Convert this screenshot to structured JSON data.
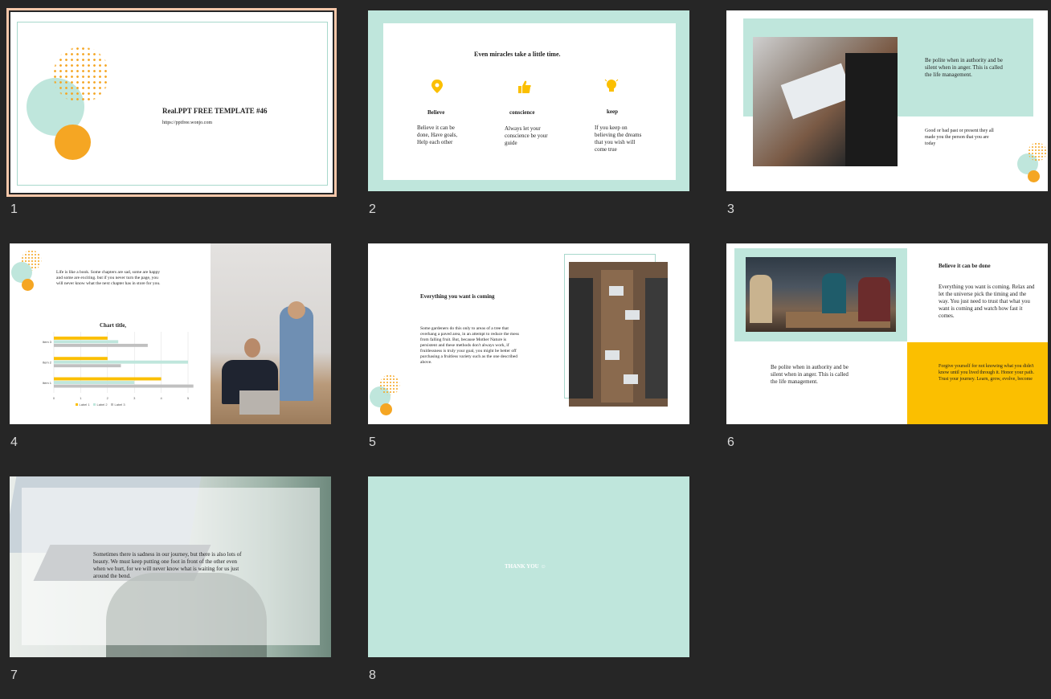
{
  "slide_numbers": [
    "1",
    "2",
    "3",
    "4",
    "5",
    "6",
    "7",
    "8"
  ],
  "colors": {
    "background": "#262626",
    "mint": "#bfe6dc",
    "orange": "#f5a623",
    "yellow": "#fbbf00",
    "selection": "#f7c7a9"
  },
  "slide1": {
    "title": "Real.PPT FREE TEMPLATE #46",
    "url": "https://pptfree.wonjo.com"
  },
  "slide2": {
    "heading": "Even miracles take a little time.",
    "columns": [
      {
        "icon": "location-pin-icon",
        "title": "Believe",
        "text": "Believe it can be done, Have goals, Help each other"
      },
      {
        "icon": "thumbs-up-icon",
        "title": "conscience",
        "text": "Always let your conscience be your guide"
      },
      {
        "icon": "lightbulb-icon",
        "title": "keep",
        "text": "If you keep on believing the dreams that you wish will come true"
      }
    ]
  },
  "slide3": {
    "text1": "Be polite when in authority and be silent when in anger. This is called the life management.",
    "text2": "Good or bad past or present they all made you the person that you are today"
  },
  "slide4": {
    "intro": "Life is like a book. Some chapters are sad, some are happy and some are exciting. but if you never turn the page, you will never know what the next chapter has in store for you.",
    "chart_title": "Chart title,"
  },
  "chart_data": {
    "type": "bar",
    "orientation": "horizontal",
    "title": "Chart title,",
    "categories": [
      "Item 1",
      "Item 2",
      "Item 3"
    ],
    "series": [
      {
        "name": "Label 1",
        "color": "#fbbf00",
        "values": [
          4.0,
          2.0,
          2.0
        ]
      },
      {
        "name": "Label 2",
        "color": "#bfe6dc",
        "values": [
          3.0,
          5.0,
          2.4
        ]
      },
      {
        "name": "Label 3",
        "color": "#c0c0c0",
        "values": [
          5.2,
          2.5,
          3.5
        ]
      }
    ],
    "xticks": [
      "0",
      "1",
      "2",
      "3",
      "4",
      "5"
    ],
    "xlim": [
      0,
      5
    ],
    "grid": true,
    "legend": "bottom"
  },
  "slide5": {
    "heading": "Everything you want is coming",
    "body": "Some gardeners do this only to areas of a tree that overhang a paved area, in an attempt to reduce the mess from falling fruit. But, because Mother Nature is persistent and these methods don't always work, if fruitlessness is truly your goal, you might be better off purchasing a fruitless variety such as the one described above."
  },
  "slide6": {
    "heading": "Believe it can be done",
    "body": "Everything you want is coming. Relax and let the universe pick the timing and the way. You just need to trust that what you want is coming and watch how fast it comes.",
    "quote": "Be polite when in authority and be silent when in anger. This is called the life management.",
    "yellow_text": "Forgive yourself for not knowing what you didn't know until you lived through it. Honor your path. Trust your journey. Learn, grow, evolve, become"
  },
  "slide7": {
    "text": "Sometimes there is sadness in our journey, but there is also lots of beauty. We must keep putting one foot in front of the other even when we hurt, for we will never know what is waiting for us just around the bend."
  },
  "slide8": {
    "text": "THANK YOU ☺"
  }
}
